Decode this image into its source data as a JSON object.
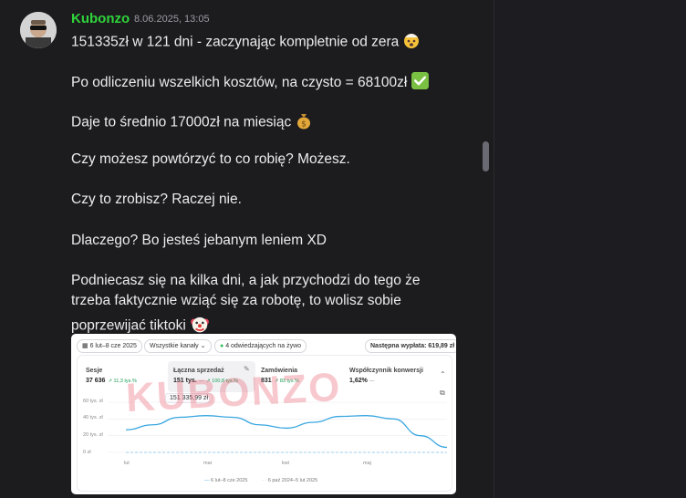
{
  "message": {
    "author": "Kubonzo",
    "timestamp": "8.06.2025, 13:05",
    "lines": [
      "151335zł w 121 dni - zaczynając kompletnie od zera",
      "Po odliczeniu wszelkich kosztów, na czysto = 68100zł",
      "Daje to średnio 17000zł na miesiąc",
      "Czy możesz powtórzyć to co robię? Możesz.",
      "Czy to zrobisz? Raczej nie.",
      "Dlaczego? Bo jesteś jebanym leniem XD",
      "Podniecasz się na kilka dni, a jak przychodzi do tego że",
      "trzeba faktycznie wziąć się za robotę, to wolisz sobie",
      "poprzewijać tiktoki"
    ]
  },
  "embed": {
    "date_range": "6 lut–8 cze 2025",
    "channels": "Wszystkie kanały",
    "live_visitors": "4 odwiedzających na żywo",
    "next_payout": "Następna wypłata: 619,89 zł",
    "watermark": "KUBONZO",
    "metrics": [
      {
        "label": "Sesje",
        "value": "37 636",
        "change": "↗ 11,3 tys.%",
        "compare": ""
      },
      {
        "label": "Łączna sprzedaż",
        "value": "151 tys.",
        "change": "↗ 100,8 tys.%",
        "compare": "—"
      },
      {
        "label": "Zamówienia",
        "value": "831",
        "change": "↗ 83 tys.%",
        "compare": ""
      },
      {
        "label": "Współczynnik konwersji",
        "value": "1,62%",
        "change": "—",
        "compare": ""
      }
    ],
    "tooltip": "151 335,99 zł",
    "legend_current": "6 lut–8 cze 2025",
    "legend_previous": "6 paź 2024–5 lut 2025"
  },
  "chart_data": {
    "type": "line",
    "x": [
      "lut",
      "mar",
      "kwi",
      "maj"
    ],
    "yticks": [
      "60 tys. zł",
      "40 tys. zł",
      "20 tys. zł",
      "0 zł"
    ],
    "ylim": [
      0,
      60000
    ],
    "series": [
      {
        "name": "6 lut–8 cze 2025",
        "color": "#3aa7e0",
        "values": [
          27000,
          33000,
          42000,
          44000,
          42000,
          33000,
          29000,
          36000,
          43000,
          44000,
          40000,
          20000,
          6000
        ]
      },
      {
        "name": "6 paź 2024–5 lut 2025",
        "color": "#9fd1f0",
        "values": [
          0,
          0
        ]
      }
    ]
  },
  "colors": {
    "author": "#2fd43a",
    "line": "#3aa7e0"
  }
}
